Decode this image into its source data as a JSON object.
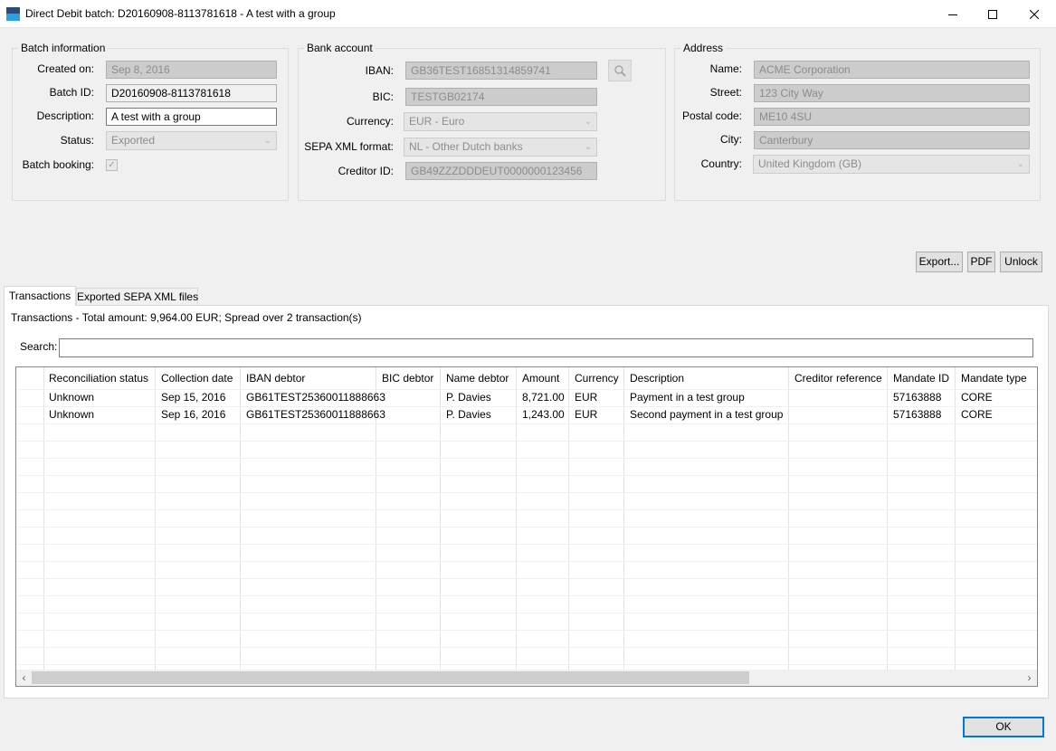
{
  "window": {
    "title": "Direct Debit batch: D20160908-8113781618 - A test with a group",
    "icons": [
      "app-icon",
      "minimize-icon",
      "maximize-icon",
      "close-icon"
    ]
  },
  "batch_info": {
    "legend": "Batch information",
    "created_on_label": "Created on:",
    "created_on": "Sep 8, 2016",
    "batch_id_label": "Batch ID:",
    "batch_id": "D20160908-8113781618",
    "description_label": "Description:",
    "description": "A test with a group",
    "status_label": "Status:",
    "status": "Exported",
    "batch_booking_label": "Batch booking:",
    "batch_booking_checked": true
  },
  "bank_account": {
    "legend": "Bank account",
    "iban_label": "IBAN:",
    "iban": "GB36TEST16851314859741",
    "bic_label": "BIC:",
    "bic": "TESTGB02174",
    "currency_label": "Currency:",
    "currency": "EUR - Euro",
    "sepa_format_label": "SEPA XML format:",
    "sepa_format": "NL - Other Dutch banks",
    "creditor_id_label": "Creditor ID:",
    "creditor_id": "GB49ZZZDDDEUT0000000123456"
  },
  "address": {
    "legend": "Address",
    "name_label": "Name:",
    "name": "ACME Corporation",
    "street_label": "Street:",
    "street": "123 City Way",
    "postal_code_label": "Postal code:",
    "postal_code": "ME10 4SU",
    "city_label": "City:",
    "city": "Canterbury",
    "country_label": "Country:",
    "country": "United Kingdom (GB)"
  },
  "actions": {
    "export": "Export...",
    "pdf": "PDF",
    "unlock": "Unlock",
    "ok": "OK"
  },
  "tabs": [
    {
      "label": "Transactions",
      "active": true
    },
    {
      "label": "Exported SEPA XML files",
      "active": false
    }
  ],
  "transactions": {
    "summary": "Transactions - Total amount: 9,964.00 EUR; Spread over 2 transaction(s)",
    "search_label": "Search:",
    "search_value": "",
    "columns": [
      "Reconciliation status",
      "Collection date",
      "IBAN debtor",
      "BIC debtor",
      "Name debtor",
      "Amount",
      "Currency",
      "Description",
      "Creditor reference",
      "Mandate ID",
      "Mandate type"
    ],
    "rows": [
      [
        "Unknown",
        "Sep 15, 2016",
        "GB61TEST25360011888663",
        "",
        "P. Davies",
        "8,721.00",
        "EUR",
        "Payment in a test group",
        "",
        "57163888",
        "CORE"
      ],
      [
        "Unknown",
        "Sep 16, 2016",
        "GB61TEST25360011888663",
        "",
        "P. Davies",
        "1,243.00",
        "EUR",
        "Second payment in a test group",
        "",
        "57163888",
        "CORE"
      ]
    ]
  }
}
